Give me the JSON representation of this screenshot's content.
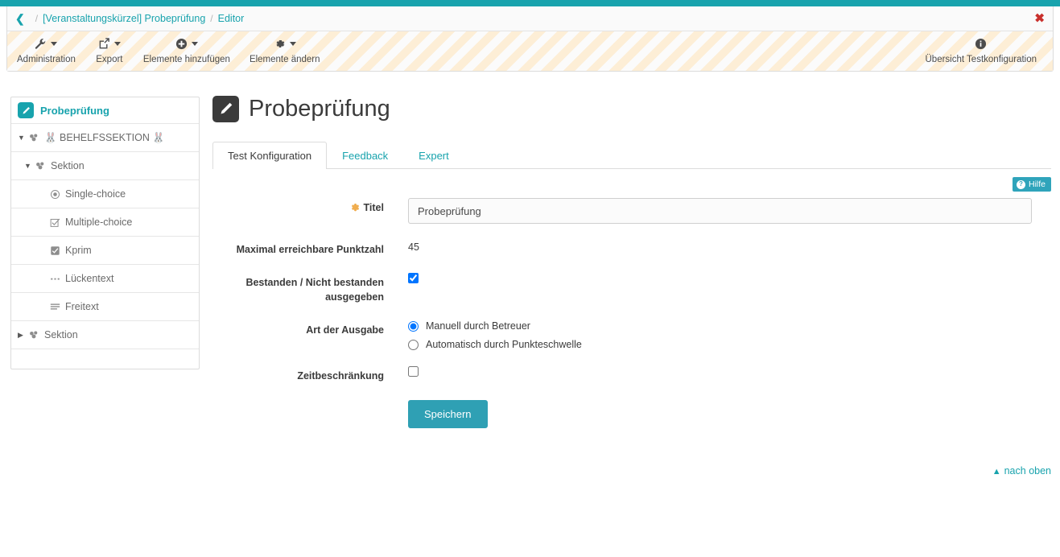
{
  "theme": {
    "accent": "#18a3ad",
    "accent_button": "#2fa0b4",
    "stripe": "#fdeed6",
    "close_red": "#c9302c",
    "required_star": "#f0ad4e"
  },
  "breadcrumb": {
    "back_icon": "chevron-left-icon",
    "separator": "/",
    "items": [
      {
        "label": "[Veranstaltungskürzel] Probeprüfung"
      },
      {
        "label": "Editor"
      }
    ],
    "close_label": "✖"
  },
  "toolbar": {
    "items": [
      {
        "label": "Administration",
        "icon": "wrench-icon",
        "glyph": "🔧",
        "caret": true
      },
      {
        "label": "Export",
        "icon": "export-icon",
        "glyph": "↪",
        "caret": true
      },
      {
        "label": "Elemente hinzufügen",
        "icon": "plus-circle-icon",
        "glyph": "➕",
        "caret": true
      },
      {
        "label": "Elemente ändern",
        "icon": "gear-icon",
        "glyph": "⚙",
        "caret": true
      }
    ],
    "right_item": {
      "label": "Übersicht Testkonfiguration",
      "icon": "info-circle-icon",
      "glyph": "ℹ"
    }
  },
  "sidebar": {
    "root": {
      "label": "Probeprüfung",
      "icon": "pencil-icon"
    },
    "items": [
      {
        "label": "🐰 BEHELFSSEKTION 🐰",
        "icon": "section-icon",
        "twisty": "down",
        "indent": 0
      },
      {
        "label": "Sektion",
        "icon": "section-icon",
        "twisty": "down",
        "indent": 1
      },
      {
        "label": "Single-choice",
        "icon": "radio-icon",
        "twisty": "",
        "indent": 2
      },
      {
        "label": "Multiple-choice",
        "icon": "checkbox-outline-icon",
        "twisty": "",
        "indent": 2
      },
      {
        "label": "Kprim",
        "icon": "checkbox-filled-icon",
        "twisty": "",
        "indent": 2
      },
      {
        "label": "Lückentext",
        "icon": "dots-icon",
        "twisty": "",
        "indent": 2
      },
      {
        "label": "Freitext",
        "icon": "lines-icon",
        "twisty": "",
        "indent": 2
      },
      {
        "label": "Sektion",
        "icon": "section-icon",
        "twisty": "right",
        "indent": 0
      }
    ]
  },
  "page": {
    "title": "Probeprüfung",
    "title_icon": "pencil-icon"
  },
  "tabs": [
    {
      "label": "Test Konfiguration",
      "active": true
    },
    {
      "label": "Feedback",
      "active": false
    },
    {
      "label": "Expert",
      "active": false
    }
  ],
  "help_badge": {
    "label": "Hilfe",
    "icon": "question-circle-icon"
  },
  "form": {
    "title_field": {
      "label": "Titel",
      "required": true,
      "required_marker": "✽",
      "value": "Probeprüfung",
      "placeholder": ""
    },
    "max_points": {
      "label": "Maximal erreichbare Punktzahl",
      "value": "45"
    },
    "pass_fail": {
      "label": "Bestanden / Nicht bestanden ausgegeben",
      "checked": true
    },
    "output_type": {
      "label": "Art der Ausgabe",
      "options": [
        {
          "label": "Manuell durch Betreuer",
          "selected": true
        },
        {
          "label": "Automatisch durch Punkteschwelle",
          "selected": false
        }
      ]
    },
    "time_limit": {
      "label": "Zeitbeschränkung",
      "checked": false
    },
    "save_label": "Speichern"
  },
  "footer": {
    "back_to_top": "nach oben",
    "back_to_top_icon": "chevron-up-icon"
  }
}
